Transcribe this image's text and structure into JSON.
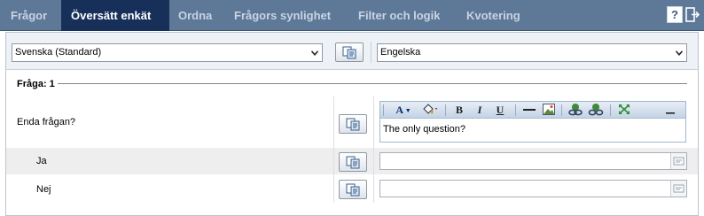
{
  "tabs": [
    {
      "label": "Frågor",
      "active": false
    },
    {
      "label": "Översätt enkät",
      "active": true
    },
    {
      "label": "Ordna",
      "active": false
    },
    {
      "label": "Frågors synlighet",
      "active": false
    },
    {
      "label": "Filter och logik",
      "active": false
    },
    {
      "label": "Kvotering",
      "active": false
    }
  ],
  "toolbar_icons": {
    "help": "?",
    "help_icon": "help-icon",
    "exit_icon": "exit-icon"
  },
  "languages": {
    "source": "Svenska (Standard)",
    "target": "Engelska"
  },
  "question": {
    "header": "Fråga: 1",
    "source_text": "Enda frågan?",
    "translated_text": "The only question?",
    "answers": [
      {
        "source": "Ja",
        "translation": ""
      },
      {
        "source": "Nej",
        "translation": ""
      }
    ]
  },
  "editor_toolbar": {
    "font_color": "A",
    "bold": "B",
    "italic": "I",
    "underline": "U"
  },
  "colors": {
    "tab_bar": "#5e7897",
    "active_tab": "#17305a",
    "panel_header": "#eef1f5",
    "shaded_row": "#eeeeef"
  }
}
